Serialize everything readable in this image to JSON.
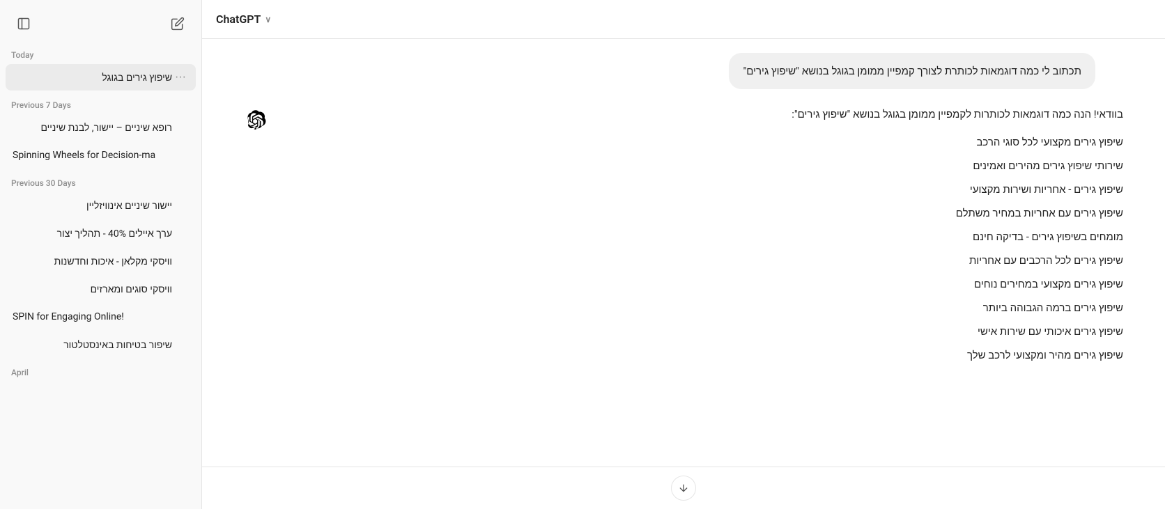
{
  "sidebar": {
    "toggle_icon": "sidebar-toggle",
    "edit_icon": "edit",
    "sections": [
      {
        "label": "Today",
        "items": [
          {
            "text": "שיפוץ גירים בגוגל",
            "active": true,
            "direction": "rtl"
          }
        ]
      },
      {
        "label": "Previous 7 Days",
        "items": [
          {
            "text": "רופא שיניים – יישור, לבנת שיניים",
            "active": false,
            "direction": "rtl"
          },
          {
            "text": "Spinning Wheels for Decision-ma",
            "active": false,
            "direction": "ltr"
          }
        ]
      },
      {
        "label": "Previous 30 Days",
        "items": [
          {
            "text": "יישור שיניים אינוויזליין",
            "active": false,
            "direction": "rtl"
          },
          {
            "text": "ערך איילים 40% - תהליך יצור",
            "active": false,
            "direction": "rtl"
          },
          {
            "text": "וויסקי מקלאן - איכות וחדשנות",
            "active": false,
            "direction": "rtl"
          },
          {
            "text": "וויסקי סוגים ומארזים",
            "active": false,
            "direction": "rtl"
          },
          {
            "text": "SPIN for Engaging Online!",
            "active": false,
            "direction": "ltr"
          },
          {
            "text": "שיפור בטיחות באינסטלטור",
            "active": false,
            "direction": "rtl"
          }
        ]
      },
      {
        "label": "April",
        "items": []
      }
    ]
  },
  "header": {
    "app_name": "ChatGPT",
    "dropdown_icon": "chevron-down"
  },
  "chat": {
    "user_message": "תכתוב לי כמה דוגמאות  לכותרת לצורך קמפיין ממומן בגוגל  בנושא \"שיפוץ גירים\"",
    "ai_intro": "בוודאי! הנה כמה דוגמאות לכותרות לקמפיין ממומן בגוגל בנושא \"שיפוץ גירים\":",
    "ai_items": [
      "שיפוץ גירים מקצועי לכל סוגי הרכב",
      "שירותי שיפוץ גירים מהירים ואמינים",
      "שיפוץ גירים - אחריות ושירות מקצועי",
      "שיפוץ גירים עם אחריות במחיר משתלם",
      "מומחים בשיפוץ גירים - בדיקה חינם",
      "שיפוץ גירים לכל הרכבים עם אחריות",
      "שיפוץ גירים מקצועי במחירים נוחים",
      "שיפוץ גירים ברמה הגבוהה ביותר",
      "שיפוץ גירים איכותי עם שירות אישי",
      "שיפוץ גירים מהיר ומקצועי לרכב שלך"
    ],
    "scroll_down_icon": "arrow-down"
  }
}
